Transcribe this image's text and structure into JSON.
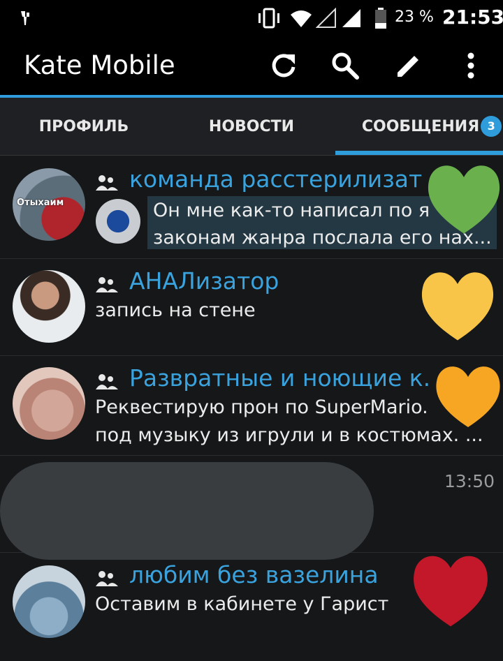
{
  "status": {
    "battery": "23 %",
    "time": "21:53"
  },
  "toolbar": {
    "title": "Kate Mobile"
  },
  "tabs": [
    {
      "label": "ПРОФИЛЬ"
    },
    {
      "label": "НОВОСТИ"
    },
    {
      "label": "СООБЩЕНИЯ",
      "badge": "3",
      "active": true
    }
  ],
  "dialogs": [
    {
      "title": "команда расстерилизато...",
      "line1": "Он мне как-то написал по я",
      "line2": "законам жанра послала его нах...",
      "avatar_text": "Отыхаим",
      "time": ""
    },
    {
      "title": "АНАЛизатор",
      "line1": "запись на стене",
      "time": ""
    },
    {
      "title": "Развратные и ноющие к...",
      "line1": "Реквестирую прон по SuperMario.",
      "line2": "под музыку из игрули и в костюмах. ...",
      "time": ""
    },
    {
      "title": "",
      "line1": "",
      "time": "13:50"
    },
    {
      "title": "любим без вазелина",
      "line1": "Оставим в кабинете у Гарист",
      "time": ""
    }
  ],
  "colors": {
    "accent": "#2f9ddc",
    "title_text": "#3aa2dd",
    "heart_green": "#6ab04c",
    "heart_yellow": "#f9c548",
    "heart_orange": "#f6a623",
    "heart_red": "#c2182a"
  }
}
